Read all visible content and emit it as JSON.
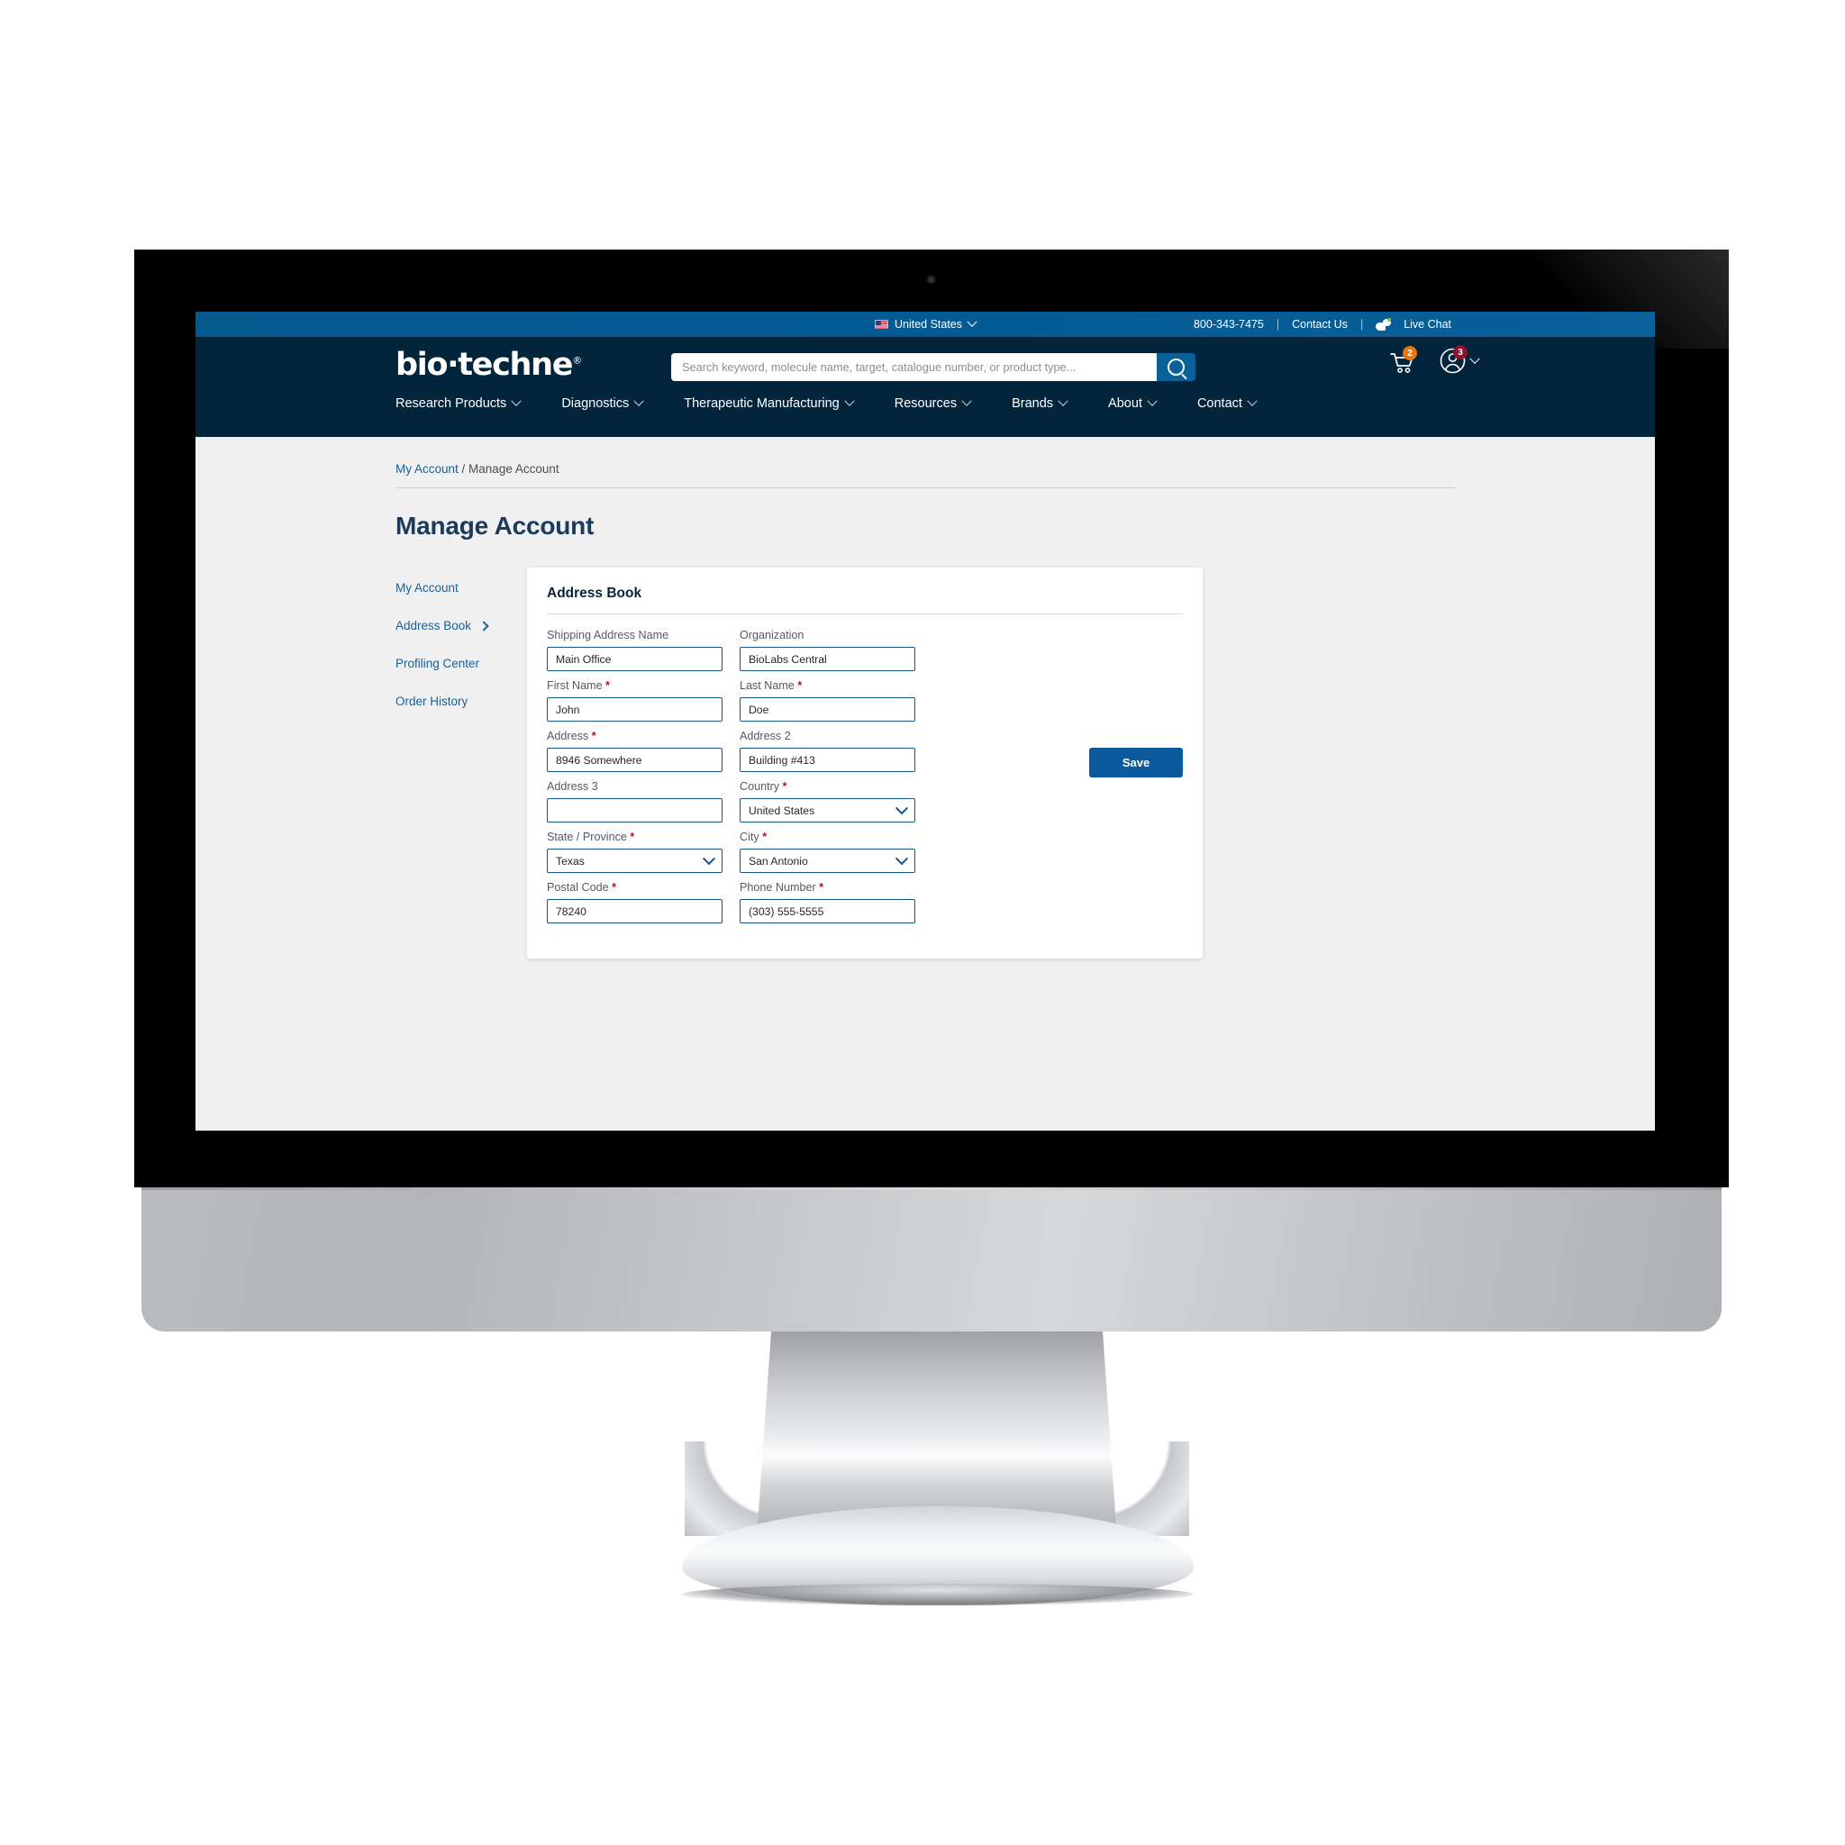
{
  "utility_bar": {
    "locale": "United States",
    "locale_icon": "us-flag-icon",
    "phone": "800-343-7475",
    "divider": "|",
    "contact_us": "Contact Us",
    "live_chat": "Live Chat",
    "live_chat_icon": "chat-bubbles-icon",
    "bg_color": "#04588f"
  },
  "masthead": {
    "logo": {
      "part1": "bio",
      "dot": "·",
      "part2": "techne",
      "mark": "®"
    },
    "search": {
      "placeholder": "Search keyword, molecule name, target, catalogue number, or product type...",
      "value": "",
      "icon": "search-icon",
      "button_color": "#0a6099"
    },
    "cart": {
      "icon": "shopping-cart-icon",
      "badge": "2",
      "badge_color": "#e87511"
    },
    "account": {
      "icon": "user-circle-icon",
      "badge": "3",
      "badge_color": "#8e1230",
      "chevron": "chevron-down-icon"
    },
    "bg_color": "#03253b"
  },
  "nav": {
    "items": [
      {
        "label": "Research Products",
        "has_chevron": true
      },
      {
        "label": "Diagnostics",
        "has_chevron": true
      },
      {
        "label": "Therapeutic Manufacturing",
        "has_chevron": true
      },
      {
        "label": "Resources",
        "has_chevron": true
      },
      {
        "label": "Brands",
        "has_chevron": true
      },
      {
        "label": "About",
        "has_chevron": true
      },
      {
        "label": "Contact",
        "has_chevron": true
      }
    ]
  },
  "breadcrumb": {
    "parent": "My Account",
    "separator": " / ",
    "current": "Manage Account"
  },
  "page_title": "Manage Account",
  "sidebar": {
    "items": [
      {
        "label": "My Account",
        "active": false,
        "arrow": false
      },
      {
        "label": "Address Book",
        "active": true,
        "arrow": true
      },
      {
        "label": "Profiling Center",
        "active": false,
        "arrow": false
      },
      {
        "label": "Order History",
        "active": false,
        "arrow": false
      }
    ]
  },
  "card": {
    "title": "Address Book",
    "fields": [
      {
        "label": "Shipping Address Name",
        "required": false,
        "value": "Main Office",
        "type": "text",
        "name": "shipping-address-name"
      },
      {
        "label": "Organization",
        "required": false,
        "value": "BioLabs Central",
        "type": "text",
        "name": "organization"
      },
      {
        "label": "First Name",
        "required": true,
        "value": "John",
        "type": "text",
        "name": "first-name"
      },
      {
        "label": "Last Name",
        "required": true,
        "value": "Doe",
        "type": "text",
        "name": "last-name"
      },
      {
        "label": "Address",
        "required": true,
        "value": "8946 Somewhere",
        "type": "text",
        "name": "address"
      },
      {
        "label": "Address 2",
        "required": false,
        "value": "Building #413",
        "type": "text",
        "name": "address-2"
      },
      {
        "label": "Address 3",
        "required": false,
        "value": "",
        "type": "text",
        "name": "address-3"
      },
      {
        "label": "Country",
        "required": true,
        "value": "United States",
        "type": "select",
        "name": "country"
      },
      {
        "label": "State / Province",
        "required": true,
        "value": "Texas",
        "type": "select",
        "name": "state-province"
      },
      {
        "label": "City",
        "required": true,
        "value": "San Antonio",
        "type": "select",
        "name": "city"
      },
      {
        "label": "Postal Code",
        "required": true,
        "value": "78240",
        "type": "text",
        "name": "postal-code"
      },
      {
        "label": "Phone Number",
        "required": true,
        "value": "(303) 555-5555",
        "type": "text",
        "name": "phone-number"
      }
    ],
    "save_label": "Save",
    "save_color": "#0c5a9e",
    "required_marker": "*"
  }
}
